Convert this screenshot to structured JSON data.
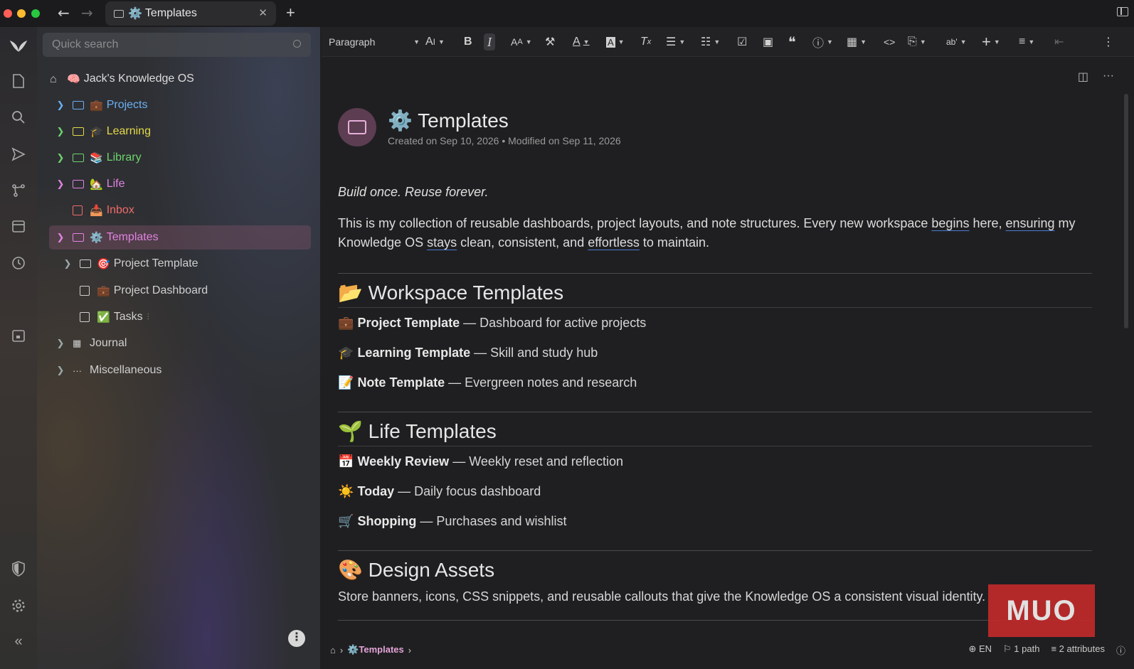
{
  "window": {
    "tab_title": "Templates",
    "tab_emoji": "⚙️"
  },
  "sidebar": {
    "quick_search_placeholder": "Quick search",
    "root": {
      "emoji": "🧠",
      "label": "Jack's Knowledge OS"
    },
    "items": [
      {
        "emoji": "💼",
        "label": "Projects",
        "color": "#6ab0f3"
      },
      {
        "emoji": "🎓",
        "label": "Learning",
        "color": "#e3d94a"
      },
      {
        "emoji": "📚",
        "label": "Library",
        "color": "#6dd36d"
      },
      {
        "emoji": "🏡",
        "label": "Life",
        "color": "#e083e0"
      },
      {
        "emoji": "📥",
        "label": "Inbox",
        "color": "#ef6b6b"
      },
      {
        "emoji": "⚙️",
        "label": "Templates",
        "color": "#e083e0"
      },
      {
        "emoji": "🎯",
        "label": "Project Template",
        "color": "#cfcfcf"
      },
      {
        "emoji": "💼",
        "label": "Project Dashboard",
        "color": "#cfcfcf"
      },
      {
        "emoji": "✅",
        "label": "Tasks",
        "color": "#cfcfcf"
      },
      {
        "emoji": "",
        "label": "Journal",
        "color": "#cfcfcf"
      },
      {
        "emoji": "",
        "label": "Miscellaneous",
        "color": "#cfcfcf"
      }
    ]
  },
  "toolbar": {
    "block_type": "Paragraph"
  },
  "note": {
    "title_emoji": "⚙️",
    "title": "Templates",
    "meta": "Created on Sep 10, 2026 • Modified on Sep 11, 2026",
    "tagline": "Build once. Reuse forever.",
    "intro_parts": {
      "p1": "This is my collection of reusable dashboards, project layouts, and note structures. Every new workspace ",
      "u1": "begins",
      "p2": " here, ",
      "u2": "ensuring",
      "p3": " my Knowledge OS ",
      "u3": "stays",
      "p4": " clean, consistent, and ",
      "u4": "effortless",
      "p5": " to maintain."
    },
    "sections": [
      {
        "emoji": "📂",
        "heading": "Workspace Templates",
        "items": [
          {
            "emoji": "💼",
            "name": "Project Template",
            "desc": " — Dashboard for active projects"
          },
          {
            "emoji": "🎓",
            "name": "Learning Template",
            "desc": " — Skill and study hub"
          },
          {
            "emoji": "📝",
            "name": "Note Template",
            "desc": " — Evergreen notes and research"
          }
        ]
      },
      {
        "emoji": "🌱",
        "heading": "Life Templates",
        "items": [
          {
            "emoji": "📅",
            "name": "Weekly Review",
            "desc": " — Weekly reset and reflection"
          },
          {
            "emoji": "☀️",
            "name": "Today",
            "desc": " — Daily focus dashboard"
          },
          {
            "emoji": "🛒",
            "name": "Shopping",
            "desc": " — Purchases and wishlist"
          }
        ]
      }
    ],
    "design": {
      "emoji": "🎨",
      "heading": "Design Assets",
      "text": "Store banners, icons, CSS snippets, and reusable callouts that give the Knowledge OS a consistent visual identity."
    }
  },
  "statusbar": {
    "breadcrumb_emoji": "⚙️",
    "breadcrumb_label": "Templates",
    "language": "EN",
    "paths": "1 path",
    "attributes": "2 attributes"
  },
  "watermark": "MUO"
}
